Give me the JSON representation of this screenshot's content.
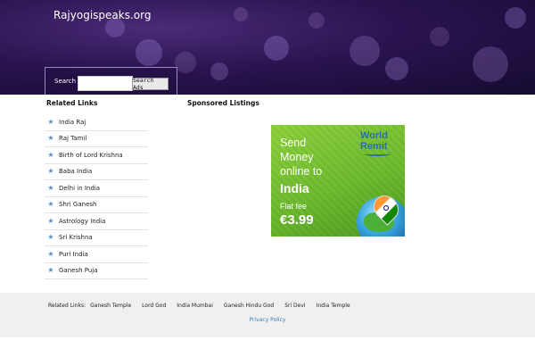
{
  "header": {
    "site_title": "Rajyogispeaks.org",
    "search_label": "Search",
    "search_value": "",
    "search_button": "Search Ads"
  },
  "related": {
    "heading": "Related Links",
    "items": [
      {
        "label": "India Raj"
      },
      {
        "label": "Raj Tamil"
      },
      {
        "label": "Birth of Lord Krishna"
      },
      {
        "label": "Baba India"
      },
      {
        "label": "Delhi in India"
      },
      {
        "label": "Shri Ganesh"
      },
      {
        "label": "Astrology India"
      },
      {
        "label": "Sri Krishna"
      },
      {
        "label": "Puri India"
      },
      {
        "label": "Ganesh Puja"
      }
    ]
  },
  "sponsored": {
    "heading": "Sponsored Listings",
    "ad": {
      "line1": "Send",
      "line2": "Money",
      "line3": "online to",
      "country": "India",
      "fee_label": "Flat fee",
      "fee": "€3.99",
      "logo_world": "World",
      "logo_remit": "Remit",
      "background_color": "#7cc236"
    }
  },
  "footer": {
    "links_label": "Related Links:",
    "links": [
      {
        "label": "Ganesh Temple"
      },
      {
        "label": "Lord God"
      },
      {
        "label": "India Mumbai"
      },
      {
        "label": "Ganesh Hindu God"
      },
      {
        "label": "Sri Devi"
      },
      {
        "label": "India Temple"
      }
    ],
    "privacy": "Privacy Policy",
    "link_color": "#3a7cc0"
  },
  "icons": {
    "list_bullet": "star-icon"
  }
}
